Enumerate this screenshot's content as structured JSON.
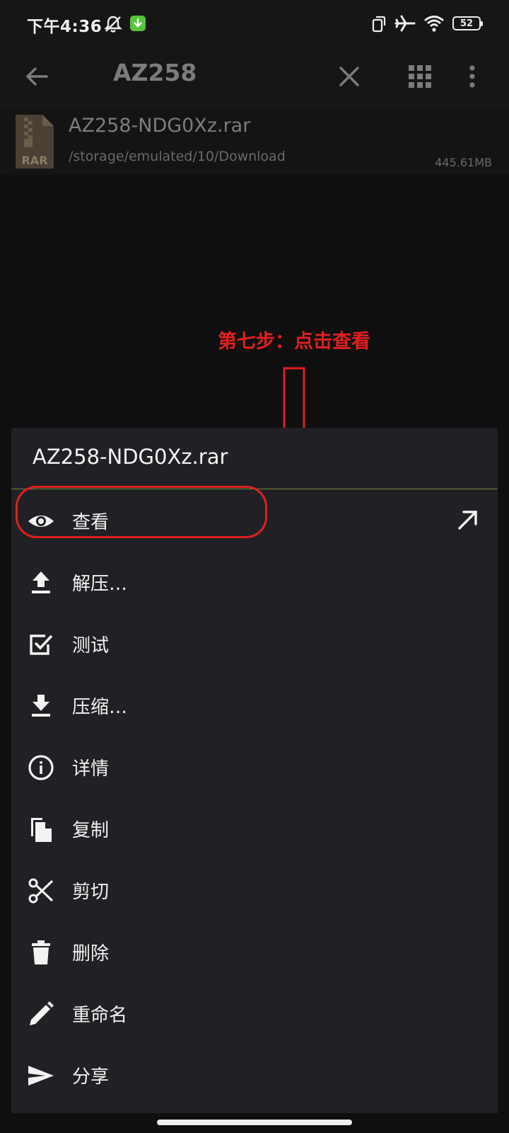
{
  "status_bar": {
    "time": "下午4:36",
    "battery": "52"
  },
  "app_bar": {
    "title": "AZ258"
  },
  "file": {
    "name": "AZ258-NDG0Xz.rar",
    "path": "/storage/emulated/10/Download",
    "size": "445.61MB",
    "icon_label": "RAR"
  },
  "annotation": {
    "text": "第七步：点击查看"
  },
  "sheet": {
    "title": "AZ258-NDG0Xz.rar",
    "items": [
      {
        "label": "查看",
        "icon": "eye-icon"
      },
      {
        "label": "解压…",
        "icon": "upload-icon"
      },
      {
        "label": "测试",
        "icon": "checkbox-icon"
      },
      {
        "label": "压缩…",
        "icon": "download-icon"
      },
      {
        "label": "详情",
        "icon": "info-icon"
      },
      {
        "label": "复制",
        "icon": "copy-icon"
      },
      {
        "label": "剪切",
        "icon": "scissors-icon"
      },
      {
        "label": "删除",
        "icon": "trash-icon"
      },
      {
        "label": "重命名",
        "icon": "pencil-icon"
      },
      {
        "label": "分享",
        "icon": "send-icon"
      }
    ]
  },
  "colors": {
    "annotation": "#e01f1f",
    "sheet_bg": "#212125",
    "download_badge": "#58c43c"
  }
}
